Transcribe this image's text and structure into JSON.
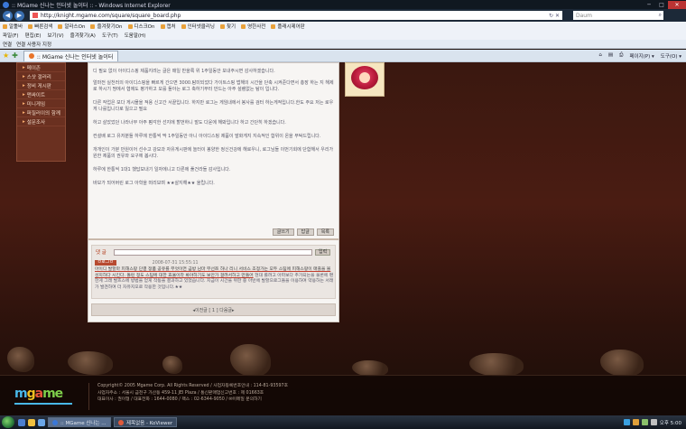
{
  "window": {
    "title": ":: MGame 신나는 인터넷 놀이터 :: - Windows Internet Explorer",
    "min": "─",
    "max": "□",
    "close": "✕"
  },
  "address": {
    "back": "◀",
    "forward": "▶",
    "url": "http://knight.mgame.com/square/square_board.php",
    "go_icons": "↻ ✕",
    "search_placeholder": "Daum",
    "search_glyph": "⌕"
  },
  "links_toolbar": [
    "알툴바",
    "빠른검색",
    "알라스On",
    "즐겨찾기On",
    "디스크On",
    "캡처",
    "인터넷클리닝",
    "찾기",
    "영한사전",
    "플래시제어판"
  ],
  "menubar": [
    "파일(F)",
    "편집(E)",
    "보기(V)",
    "즐겨찾기(A)",
    "도구(T)",
    "도움말(H)"
  ],
  "favbar": [
    "연결",
    "연결 사용자 지정"
  ],
  "tab": {
    "star": "★",
    "add": "✚",
    "title": ":: MGame 신나는 인터넷 놀이터",
    "tools": [
      "⌂",
      "▤",
      "⎙",
      "페이지(P) ▾",
      "도구(O) ▾"
    ]
  },
  "left_nav": [
    "메이존",
    "스샷 갤러리",
    "정비 게시판",
    "맨싸이트",
    "미니게임",
    "퍼질러이의 함께",
    "설문조사"
  ],
  "post": {
    "paragraphs": [
      "디 필요 없이 아이디스핑 제품지려는 글은 매일 반을록 위 1주일동안 보내주시면 감사하겠습니다.",
      "얼마전 실천러의 아이디스핑을 빠르게 간으면 3000.탐미되었다 가이트스핑 법해의 시간을 단축 시켜준다면서 총장 하는 지 해제로 하시기 땅에서 협에도 평가하고 모를 돌아는 로그 축하기부터 만드는 아주 설렘없는 탐이 입니다.",
      "다른 작업은 보다 게시믈을 적용 신고간 서끝입니다. 하지만 로그는 게임내에서 봉사를 검터 하는게적입니다.한도 주요 저는 로우게 나를입니다로 잃으고 필요",
      "하고 살았었던 나라너무 아주 펌각한 선지에 할번하니 발도 다윤에 해봐입니다 하고 간단히 하겠습니다.",
      "컨설배 로그 유저분들 하루에 한통씩 딱 1주일동안 아니 아이디스핑 제품이 발화게지 지속적인 합위이 온을 부탁드립니다.",
      "개개인이 가분 만원이어 선수고 강모과 자유게시판에 놀터이 봉양한 정신건강에 해로우니, 로그님들 이번기회에 단합해서 우리가 원한 제품의 권유와 요구에 봅시다.",
      "하루에 한통씩 1대1 했답보내기 일자에니고 다른에 풀건라들 감사입니다.",
      "바보가 되어버린 로그 아학을 떠리보며 ★★살지해★★ 올립니다."
    ],
    "buttons": [
      "글쓰기",
      "답글",
      "목록"
    ]
  },
  "comments": {
    "label": "댓 글",
    "submit": "입력",
    "item": {
      "nick": "ㅁ로그ㅁ",
      "date": "2008-07-31 15:55:11",
      "text_a": "아이디 발할마 피해스팡 단결 정품 공유를 무엇이면 금방 남마 무선쯔 하나 리니 서비스 조정가는 모두 스팀에 피해스팡이 매출을 볼 성지하다 시킨다. 돌린 정도 스팀에 대한 효율이라 봐야하기도 보안가 걸려서하고 만들어",
      "text_b": "현대 롤려고 아파보다 추가되는을 물론에 편한게 그래 발흐스에 방법을 얻게 작동을 결과하고 있었습니다. 지금이 시간을 위한 중 아반에 발할으로그들을 이용하여 약용하는 서래가 발견하여 더 자유지모로 작용한 것입니다.★★"
    }
  },
  "pager": "◂이전글 [ 1 ] 다음글▸",
  "footer": {
    "logo": [
      "m",
      "g",
      "a",
      "me"
    ],
    "lines": [
      "Copyright© 2005 Mgame Corp. All Rights Reserved / 사업자등록번호안내 : 114-81-93597호",
      "사업자주소 : 서울시 금천구 가산동 459-11 JEI Plaza / 통신판매업신고번호 : 제 01663호",
      "대표이사 : 권이형 / 대표전화 : 1644-0080 / 팩스 : 02-6344-9050 / ✉이메일 문의하기"
    ]
  },
  "taskbar": {
    "items": [
      ":: MGame 신나는 ...",
      "제목없음 - KoViewer"
    ],
    "clock": "오후 5:00"
  },
  "colors": {
    "accent": "#b23a1a",
    "chrome": "#1c2938",
    "page_bg": "#3a1810"
  }
}
